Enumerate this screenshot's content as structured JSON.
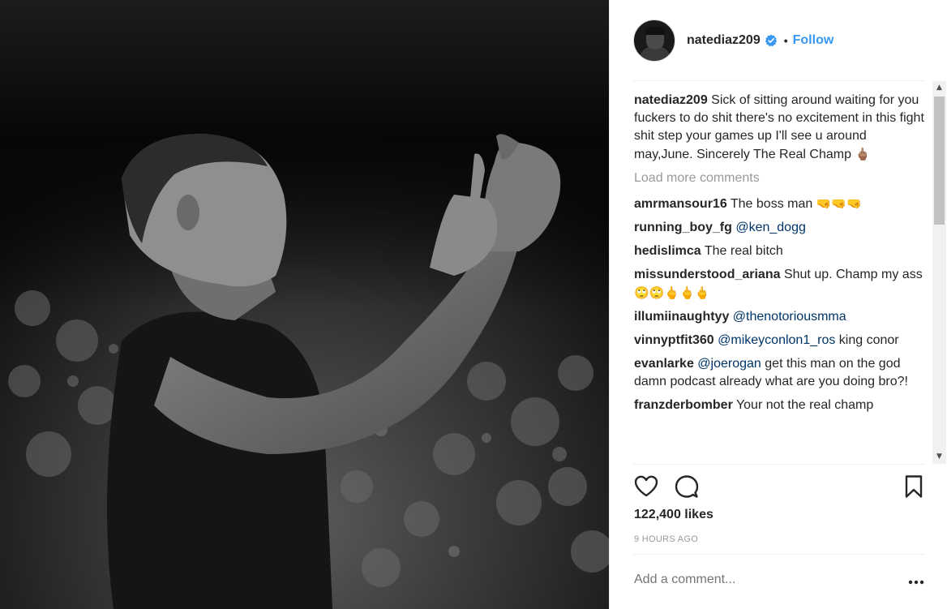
{
  "post": {
    "username": "natediaz209",
    "follow_label": "Follow",
    "dot": "•",
    "caption": {
      "user": "natediaz209",
      "text": "Sick of sitting around waiting for you fuckers to do shit there's no excitement in this fight shit step your games up I'll see u around may,June. Sincerely The Real Champ",
      "emoji": "🖕🏽"
    },
    "load_more_label": "Load more comments",
    "comments": [
      {
        "user": "amrmansour16",
        "text": "The boss man",
        "emoji": "🤜🤜🤜"
      },
      {
        "user": "running_boy_fg",
        "mention": "@ken_dogg"
      },
      {
        "user": "hedislimca",
        "text": "The real bitch"
      },
      {
        "user": "missunderstood_ariana",
        "text": "Shut up. Champ my ass",
        "emoji": "🙄🙄🖕🖕🖕"
      },
      {
        "user": "illumiinaughtyy",
        "mention": "@thenotoriousmma"
      },
      {
        "user": "vinnyptfit360",
        "mention": "@mikeyconlon1_ros",
        "text": "king conor"
      },
      {
        "user": "evanlarke",
        "mention": "@joerogan",
        "text": "get this man on the god damn podcast already what are you doing bro?!"
      },
      {
        "user": "franzderbomber",
        "text": "Your not the real champ"
      }
    ],
    "likes": "122,400 likes",
    "timestamp": "9 HOURS AGO",
    "add_comment_placeholder": "Add a comment..."
  },
  "icons": {
    "like": "heart-icon",
    "comment": "comment-bubble-icon",
    "save": "bookmark-icon",
    "more": "more-options-icon",
    "verified": "verified-badge-icon"
  },
  "colors": {
    "link": "#3897f0",
    "mention": "#003569",
    "muted": "#999999",
    "text": "#262626"
  }
}
